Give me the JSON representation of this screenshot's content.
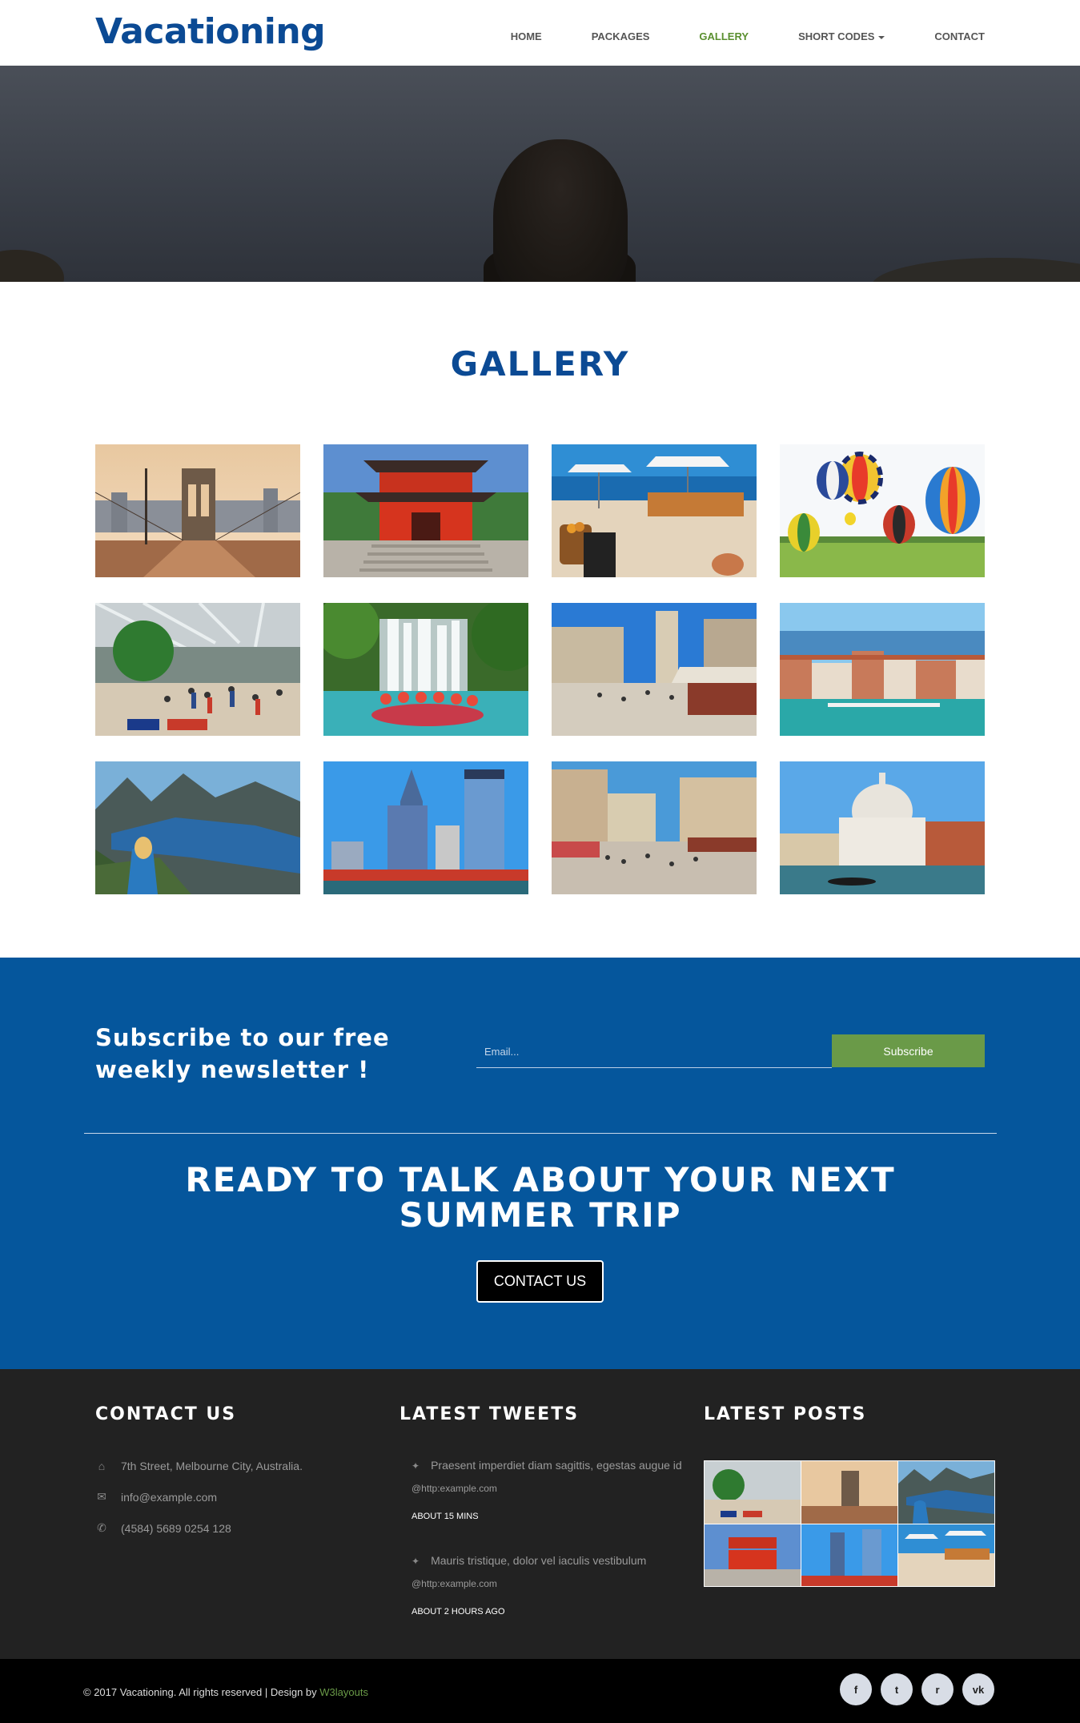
{
  "header": {
    "logo": "Vacationing",
    "nav": [
      {
        "label": "HOME"
      },
      {
        "label": "PACKAGES"
      },
      {
        "label": "GALLERY"
      },
      {
        "label": "SHORT CODES"
      },
      {
        "label": "CONTACT"
      }
    ],
    "active_item": "GALLERY"
  },
  "gallery": {
    "title": "GALLERY",
    "images": [
      {
        "subject": "brooklyn-bridge"
      },
      {
        "subject": "japanese-temple-gate"
      },
      {
        "subject": "seaside-cafe"
      },
      {
        "subject": "hot-air-balloons"
      },
      {
        "subject": "airport-terminal"
      },
      {
        "subject": "waterfall-rafting"
      },
      {
        "subject": "old-town-square"
      },
      {
        "subject": "venice-waterfront"
      },
      {
        "subject": "mountain-fjord-view"
      },
      {
        "subject": "city-skyscrapers"
      },
      {
        "subject": "street-market"
      },
      {
        "subject": "venice-basilica"
      }
    ]
  },
  "subscribe": {
    "heading": "Subscribe to our free weekly newsletter !",
    "email_placeholder": "Email...",
    "button_label": "Subscribe"
  },
  "cta": {
    "heading": "READY TO TALK ABOUT YOUR NEXT SUMMER TRIP",
    "button_label": "CONTACT US"
  },
  "footer": {
    "contact": {
      "title": "CONTACT US",
      "address": "7th Street, Melbourne City, Australia.",
      "email": "info@example.com",
      "phone": "(4584) 5689 0254 128"
    },
    "tweets": {
      "title": "LATEST TWEETS",
      "items": [
        {
          "text": "Praesent imperdiet diam sagittis, egestas augue id",
          "link": "@http:example.com",
          "ago": "ABOUT 15 MINS"
        },
        {
          "text": "Mauris tristique, dolor vel iaculis vestibulum",
          "link": "@http:example.com",
          "ago": "ABOUT 2 HOURS AGO"
        }
      ]
    },
    "posts": {
      "title": "LATEST POSTS"
    }
  },
  "bottom": {
    "copyright": "© 2017 Vacationing. All rights reserved | Design by",
    "designer": "W3layouts",
    "socials": [
      {
        "icon": "facebook-icon",
        "glyph": "f"
      },
      {
        "icon": "twitter-icon",
        "glyph": "t"
      },
      {
        "icon": "rss-icon",
        "glyph": "r"
      },
      {
        "icon": "vk-icon",
        "glyph": "vk"
      }
    ]
  },
  "colors": {
    "brand_blue": "#0b4a94",
    "section_blue": "#05569c",
    "accent_green": "#6a9a48",
    "footer_dark": "#222222"
  }
}
